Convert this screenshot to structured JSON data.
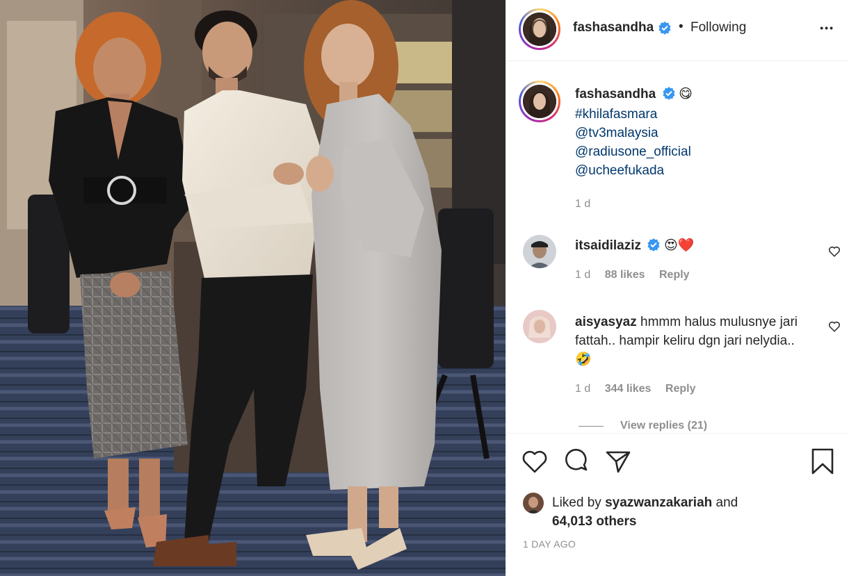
{
  "post": {
    "username": "fashasandha",
    "follow_state": "Following",
    "separator": "•",
    "more_label": "•••"
  },
  "caption": {
    "username": "fashasandha",
    "emoji": "😋",
    "lines": [
      "#khilafasmara",
      "@tv3malaysia",
      "@radiusone_official",
      "@ucheefukada"
    ],
    "age": "1 d"
  },
  "comments": [
    {
      "username": "itsaidilaziz",
      "text": "😍❤️",
      "age": "1 d",
      "likes": "88 likes",
      "reply": "Reply"
    },
    {
      "username": "aisyasyaz",
      "text": "hmmm halus mulusnye jari fattah.. hampir keliru dgn jari nelydia.. 🤣",
      "age": "1 d",
      "likes": "344 likes",
      "reply": "Reply"
    }
  ],
  "view_replies": "View replies (21)",
  "likes": {
    "prefix": "Liked by",
    "user": "syazwanzakariah",
    "conj": "and",
    "others": "64,013 others"
  },
  "timestamp": "1 DAY AGO",
  "icons": [
    "heart-icon",
    "comment-icon",
    "share-icon",
    "bookmark-icon",
    "verified-badge-icon",
    "more-icon"
  ],
  "colors": {
    "link": "#00376b",
    "verified": "#3897f0",
    "muted": "#8e8e8e",
    "text": "#262626"
  }
}
